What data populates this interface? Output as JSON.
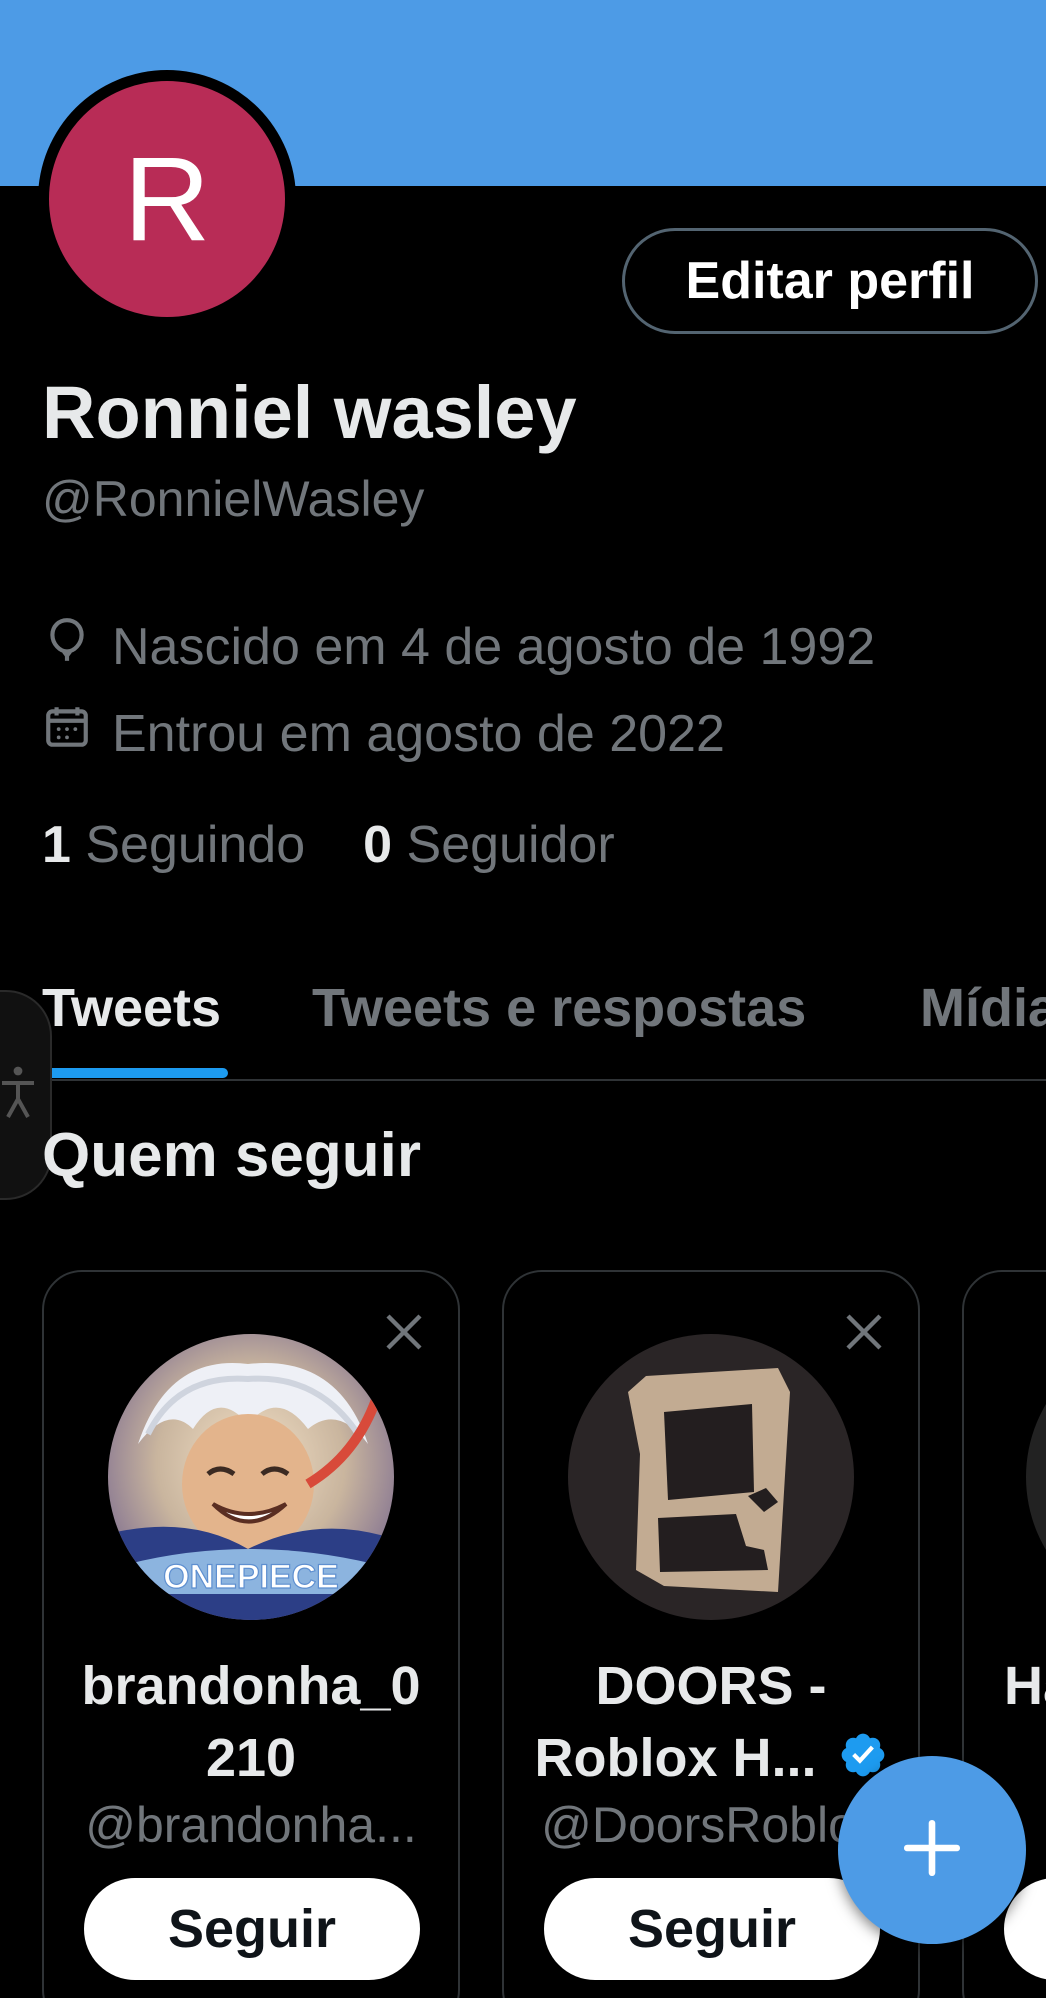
{
  "colors": {
    "banner": "#4d9be6",
    "avatar_bg": "#b82c56",
    "accent": "#1d9bf0",
    "fab": "#4d9be6"
  },
  "profile": {
    "avatar_letter": "R",
    "display_name": "Ronniel wasley",
    "handle": "@RonnielWasley",
    "edit_button": "Editar perfil",
    "birth": {
      "icon": "balloon-icon",
      "text": "Nascido em 4 de agosto de 1992"
    },
    "joined": {
      "icon": "calendar-icon",
      "text": "Entrou em agosto de 2022"
    },
    "following": {
      "count": "1",
      "label": "Seguindo"
    },
    "followers": {
      "count": "0",
      "label": "Seguidor"
    }
  },
  "tabs": [
    {
      "label": "Tweets",
      "active": true
    },
    {
      "label": "Tweets e respostas",
      "active": false
    },
    {
      "label": "Mídia",
      "active": false
    }
  ],
  "who_to_follow": {
    "title": "Quem seguir",
    "cards": [
      {
        "name": "brandonha_0 210",
        "handle": "@brandonha...",
        "verified": false,
        "button": "Seguir",
        "avatar": "onepiece-avatar"
      },
      {
        "name": "DOORS - Roblox H...",
        "handle": "@DoorsRoblox",
        "verified": true,
        "button": "Seguir",
        "avatar": "doors-avatar"
      },
      {
        "name": "Ha",
        "handle": "",
        "verified": false,
        "button": "",
        "avatar": "partial-avatar"
      }
    ]
  },
  "fab": {
    "icon": "plus-icon"
  }
}
